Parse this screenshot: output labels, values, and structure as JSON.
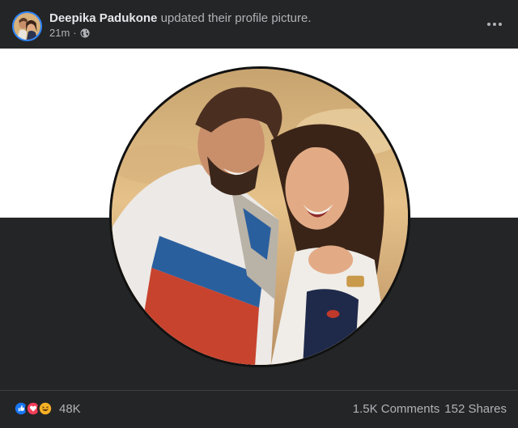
{
  "post": {
    "author": "Deepika Padukone",
    "action": "updated their profile picture.",
    "time": "21m",
    "separator": "·",
    "privacy_icon": "globe-icon",
    "more_icon": "more-options-icon"
  },
  "photo": {
    "description_icon": "profile-picture",
    "background_top": "#ffffff",
    "background_bottom": "#242526"
  },
  "footer": {
    "reactions": [
      "like-icon",
      "love-icon",
      "haha-icon"
    ],
    "reaction_count": "48K",
    "comments": "1.5K Comments",
    "shares": "152 Shares"
  },
  "colors": {
    "surface": "#242526",
    "primary_text": "#e4e6eb",
    "secondary_text": "#b0b3b8",
    "like_blue": "#1877f2",
    "love_red": "#f33e58",
    "haha_yellow": "#f7b125"
  }
}
